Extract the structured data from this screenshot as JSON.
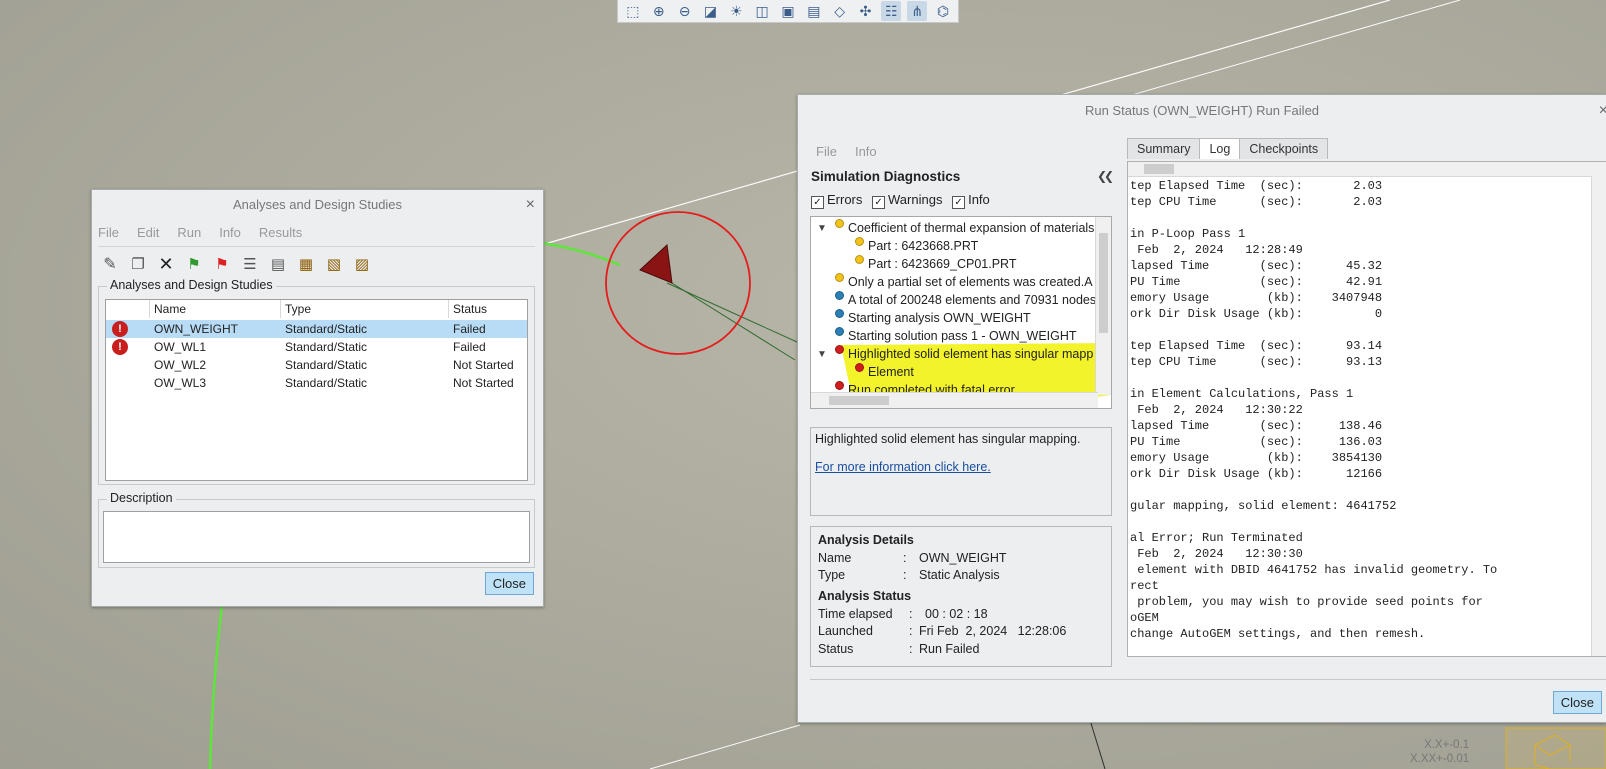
{
  "top_toolbar": {
    "icons": [
      "refit-icon",
      "zoom-in-icon",
      "zoom-out-icon",
      "repaint-icon",
      "light-icon",
      "display-style-icon",
      "saved-views-icon",
      "view-manager-icon",
      "perspective-icon",
      "datum-display-icon",
      "annotation-display-icon",
      "spin-center-icon",
      "model-tree-icon"
    ]
  },
  "analyses": {
    "title": "Analyses and Design Studies",
    "close_x": "×",
    "menu": [
      "File",
      "Edit",
      "Run",
      "Info",
      "Results"
    ],
    "group_label": "Analyses and Design Studies",
    "columns": [
      "Name",
      "Type",
      "Status"
    ],
    "rows": [
      {
        "name": "OWN_WEIGHT",
        "type": "Standard/Static",
        "status": "Failed",
        "error": true,
        "selected": true
      },
      {
        "name": "OW_WL1",
        "type": "Standard/Static",
        "status": "Failed",
        "error": true,
        "selected": false
      },
      {
        "name": "OW_WL2",
        "type": "Standard/Static",
        "status": "Not Started",
        "error": false,
        "selected": false
      },
      {
        "name": "OW_WL3",
        "type": "Standard/Static",
        "status": "Not Started",
        "error": false,
        "selected": false
      }
    ],
    "description_label": "Description",
    "close_label": "Close",
    "error_glyph": "!"
  },
  "run_status": {
    "title": "Run Status (OWN_WEIGHT) Run Failed",
    "close_x": "×",
    "menu": [
      "File",
      "Info"
    ],
    "diagnostics_title": "Simulation Diagnostics",
    "collapse_glyph": "❮❮",
    "filters": {
      "errors": "Errors",
      "warnings": "Warnings",
      "info": "Info"
    },
    "check_glyph": "✓",
    "tree": [
      {
        "text": "Coefficient of thermal expansion of materials",
        "dot": "yellow",
        "level": 0,
        "caret": "▼"
      },
      {
        "text": "Part : 6423668.PRT",
        "dot": "yellow",
        "level": 1
      },
      {
        "text": "Part : 6423669_CP01.PRT",
        "dot": "yellow",
        "level": 1
      },
      {
        "text": "Only a partial set of elements was created.A",
        "dot": "yellow",
        "level": 0
      },
      {
        "text": "A total of 200248 elements and 70931 nodes",
        "dot": "blue",
        "level": 0
      },
      {
        "text": "Starting analysis OWN_WEIGHT",
        "dot": "blue",
        "level": 0
      },
      {
        "text": "Starting solution pass 1 - OWN_WEIGHT",
        "dot": "blue",
        "level": 0
      },
      {
        "text": "Highlighted solid element has singular mapp",
        "dot": "red",
        "level": 0,
        "caret": "▼"
      },
      {
        "text": "Element",
        "dot": "red",
        "level": 1
      },
      {
        "text": "Run completed with fatal error",
        "dot": "red",
        "level": 0
      }
    ],
    "message": "Highlighted solid element has singular mapping.",
    "link": "For more information click here.",
    "details_title": "Analysis Details",
    "name_label": "Name",
    "name_value": "OWN_WEIGHT",
    "type_label": "Type",
    "type_value": "Static Analysis",
    "status_title": "Analysis Status",
    "elapsed_label": "Time elapsed",
    "elapsed_value": "00 : 02 : 18",
    "launched_label": "Launched",
    "launched_value": "Fri Feb  2, 2024   12:28:06",
    "status_label": "Status",
    "status_value": "Run Failed",
    "colon": ":",
    "tabs": [
      "Summary",
      "Log",
      "Checkpoints"
    ],
    "log": "tep Elapsed Time  (sec):       2.03\ntep CPU Time      (sec):       2.03\n\nin P-Loop Pass 1\n Feb  2, 2024   12:28:49\nlapsed Time       (sec):      45.32\nPU Time           (sec):      42.91\nemory Usage        (kb):    3407948\nork Dir Disk Usage (kb):          0\n\ntep Elapsed Time  (sec):      93.14\ntep CPU Time      (sec):      93.13\n\nin Element Calculations, Pass 1\n Feb  2, 2024   12:30:22\nlapsed Time       (sec):     138.46\nPU Time           (sec):     136.03\nemory Usage        (kb):    3854130\nork Dir Disk Usage (kb):      12166\n\ngular mapping, solid element: 4641752\n\nal Error; Run Terminated\n Feb  2, 2024   12:30:30\n element with DBID 4641752 has invalid geometry. To\nrect\n problem, you may wish to provide seed points for\noGEM\nchange AutoGEM settings, and then remesh.",
    "close_label": "Close"
  },
  "corner_readout": {
    "line1": "X.X+-0.1",
    "line2": "X.XX+-0.01"
  },
  "colors": {
    "highlight": "#f2f21a",
    "selection": "#b8dcf6",
    "error": "#c81e1e",
    "link": "#1a4fa0"
  }
}
